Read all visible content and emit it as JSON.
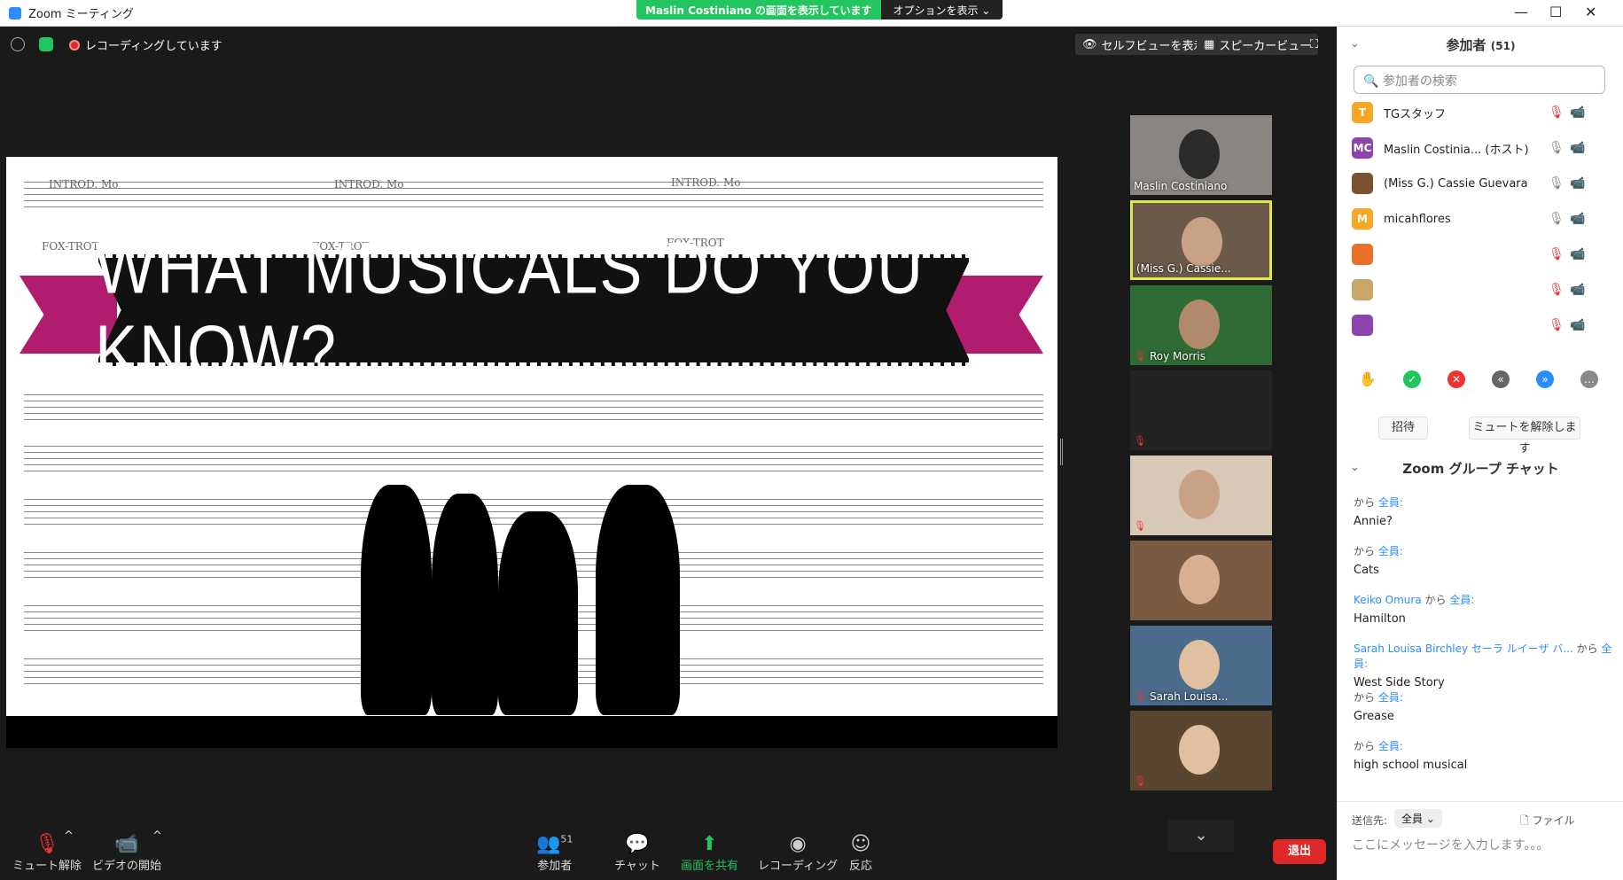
{
  "window": {
    "title": "Zoom ミーティング",
    "share_banner": "Maslin Costiniano の画面を表示しています",
    "options_label": "オプションを表示 ⌄",
    "minimize": "—",
    "maximize": "☐",
    "close": "✕"
  },
  "topbar": {
    "recording_label": "レコーディングしています",
    "self_view_label": "セルフビューを表示",
    "speaker_view_label": "スピーカービュー"
  },
  "slide": {
    "title": "WHAT MUSICALS DO YOU KNOW?",
    "staff_text": [
      "INTROD. Mo",
      "INTROD. Mo",
      "INTROD. Mo",
      "FOX-TROT",
      "FOX-TROT",
      "FOX-TROT"
    ]
  },
  "filmstrip": [
    {
      "name": "Maslin Costiniano",
      "active": false,
      "muted": false
    },
    {
      "name": "(Miss G.) Cassie...",
      "active": true,
      "muted": false
    },
    {
      "name": "Roy Morris",
      "active": false,
      "muted": true
    },
    {
      "name": "",
      "active": false,
      "muted": true
    },
    {
      "name": "",
      "active": false,
      "muted": true
    },
    {
      "name": "",
      "active": false,
      "muted": false
    },
    {
      "name": "Sarah Louisa...",
      "active": false,
      "muted": true
    },
    {
      "name": "",
      "active": false,
      "muted": true
    }
  ],
  "toolbar": {
    "unmute_label": "ミュート解除",
    "start_video_label": "ビデオの開始",
    "participants_label": "参加者",
    "participants_count": "51",
    "chat_label": "チャット",
    "share_label": "画面を共有",
    "record_label": "レコーディング",
    "reactions_label": "反応",
    "leave_label": "退出"
  },
  "panel": {
    "title": "参加者",
    "count": "(51)",
    "search_placeholder": "参加者の検索",
    "participants": [
      {
        "initials": "T",
        "color": "#f5a623",
        "name": "TGスタッフ",
        "blur": false,
        "mic_off": true,
        "cam_off": true
      },
      {
        "initials": "MC",
        "color": "#8e44ad",
        "name": "Maslin Costinia... (ホスト)",
        "blur": false,
        "mic_off": false,
        "cam_off": false
      },
      {
        "initials": "",
        "color": "#7a5230",
        "name": "(Miss G.) Cassie Guevara",
        "blur": false,
        "mic_off": false,
        "cam_off": false
      },
      {
        "initials": "M",
        "color": "#f5a623",
        "name": "micahflores",
        "blur": false,
        "mic_off": false,
        "cam_off": false
      },
      {
        "initials": "",
        "color": "#e8702a",
        "name": "",
        "blur": true,
        "mic_off": true,
        "cam_off": true
      },
      {
        "initials": "",
        "color": "#c9a56a",
        "name": "",
        "blur": true,
        "mic_off": true,
        "cam_off": true
      },
      {
        "initials": "",
        "color": "#8e44ad",
        "name": "",
        "blur": true,
        "mic_off": true,
        "cam_off": true
      }
    ],
    "invite_label": "招待",
    "unmute_all_label": "ミュートを解除します",
    "chat_title": "Zoom グループ チャット",
    "messages": [
      {
        "sender": "",
        "to": "全員:",
        "text": "Annie?"
      },
      {
        "sender": "",
        "to": "全員:",
        "text": "Cats"
      },
      {
        "sender": "Keiko Omura",
        "to": "全員:",
        "text": "Hamilton"
      },
      {
        "sender": "Sarah Louisa Birchley セーラ ルイーザ バ...",
        "to": "全員:",
        "text": "West Side Story"
      },
      {
        "sender": "",
        "to": "全員:",
        "text": "Grease"
      },
      {
        "sender": "",
        "to": "全員:",
        "text": "high school musical"
      }
    ],
    "from_word": "から",
    "send_to_label": "送信先:",
    "send_to_value": "全員 ⌄",
    "file_label": "ファイル",
    "message_placeholder": "ここにメッセージを入力します。。。"
  }
}
